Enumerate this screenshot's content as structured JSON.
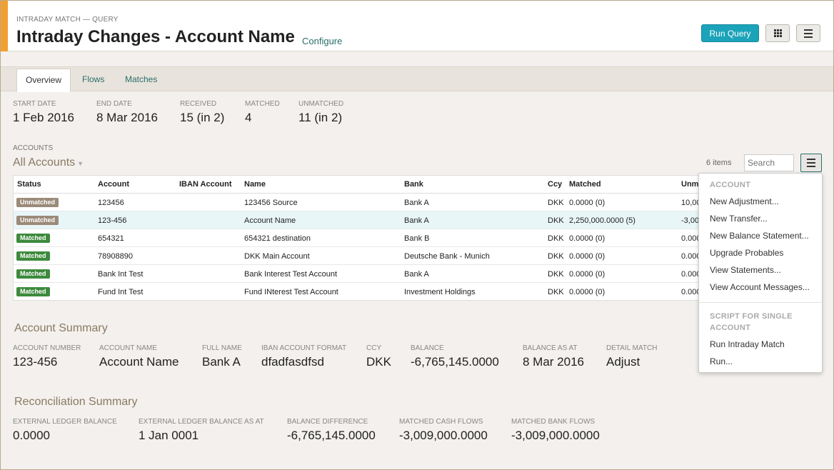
{
  "header": {
    "eyebrow": "INTRADAY MATCH — QUERY",
    "title": "Intraday Changes - Account Name",
    "configure": "Configure",
    "run_query": "Run Query",
    "accent_color": "#f0a030",
    "button_color": "#1ba3b9"
  },
  "tabs": [
    {
      "label": "Overview",
      "active": true
    },
    {
      "label": "Flows",
      "active": false
    },
    {
      "label": "Matches",
      "active": false
    }
  ],
  "stats": [
    {
      "label": "START DATE",
      "value": "1 Feb 2016"
    },
    {
      "label": "END DATE",
      "value": "8 Mar 2016"
    },
    {
      "label": "RECEIVED",
      "value": "15 (in 2)"
    },
    {
      "label": "MATCHED",
      "value": "4"
    },
    {
      "label": "UNMATCHED",
      "value": "11 (in 2)"
    }
  ],
  "accounts": {
    "label": "ACCOUNTS",
    "selector": "All Accounts",
    "count": "6 items",
    "search_placeholder": "Search",
    "columns": [
      "Status",
      "Account",
      "IBAN Account",
      "Name",
      "Bank",
      "Ccy",
      "Matched",
      "Unm"
    ],
    "rows": [
      {
        "status": "Unmatched",
        "account": "123456",
        "iban": "",
        "name": "123456 Source",
        "bank": "Bank A",
        "ccy": "DKK",
        "matched": "0.0000 (0)",
        "unmatched": "10,00"
      },
      {
        "status": "Unmatched",
        "account": "123-456",
        "iban": "",
        "name": "Account Name",
        "bank": "Bank A",
        "ccy": "DKK",
        "matched": "2,250,000.0000 (5)",
        "unmatched": "-3,00"
      },
      {
        "status": "Matched",
        "account": "654321",
        "iban": "",
        "name": "654321 destination",
        "bank": "Bank B",
        "ccy": "DKK",
        "matched": "0.0000 (0)",
        "unmatched": "0.000"
      },
      {
        "status": "Matched",
        "account": "78908890",
        "iban": "",
        "name": "DKK Main Account",
        "bank": "Deutsche Bank - Munich",
        "ccy": "DKK",
        "matched": "0.0000 (0)",
        "unmatched": "0.000"
      },
      {
        "status": "Matched",
        "account": "Bank Int Test",
        "iban": "",
        "name": "Bank Interest Test Account",
        "bank": "Bank A",
        "ccy": "DKK",
        "matched": "0.0000 (0)",
        "unmatched": "0.000"
      },
      {
        "status": "Matched",
        "account": "Fund Int Test",
        "iban": "",
        "name": "Fund INterest Test Account",
        "bank": "Investment Holdings",
        "ccy": "DKK",
        "matched": "0.0000 (0)",
        "unmatched": "0.000"
      }
    ]
  },
  "menu": {
    "account_heading": "ACCOUNT",
    "account_items": [
      "New Adjustment...",
      "New Transfer...",
      "New Balance Statement...",
      "Upgrade Probables",
      "View Statements...",
      "View Account Messages..."
    ],
    "script_heading": "SCRIPT FOR SINGLE ACCOUNT",
    "script_items": [
      "Run Intraday Match",
      "Run..."
    ]
  },
  "account_summary": {
    "title": "Account Summary",
    "fields": [
      {
        "label": "ACCOUNT NUMBER",
        "value": "123-456"
      },
      {
        "label": "ACCOUNT NAME",
        "value": "Account Name"
      },
      {
        "label": "FULL NAME",
        "value": "Bank A"
      },
      {
        "label": "IBAN ACCOUNT FORMAT",
        "value": "dfadfasdfsd"
      },
      {
        "label": "CCY",
        "value": "DKK"
      },
      {
        "label": "BALANCE",
        "value": "-6,765,145.0000"
      },
      {
        "label": "BALANCE AS AT",
        "value": "8 Mar 2016"
      },
      {
        "label": "DETAIL MATCH",
        "value": "Adjust"
      }
    ]
  },
  "reconciliation_summary": {
    "title": "Reconciliation Summary",
    "fields": [
      {
        "label": "EXTERNAL LEDGER BALANCE",
        "value": "0.0000"
      },
      {
        "label": "EXTERNAL LEDGER BALANCE AS AT",
        "value": "1 Jan 0001"
      },
      {
        "label": "BALANCE DIFFERENCE",
        "value": "-6,765,145.0000"
      },
      {
        "label": "MATCHED CASH FLOWS",
        "value": "-3,009,000.0000"
      },
      {
        "label": "MATCHED BANK FLOWS",
        "value": "-3,009,000.0000"
      }
    ]
  }
}
